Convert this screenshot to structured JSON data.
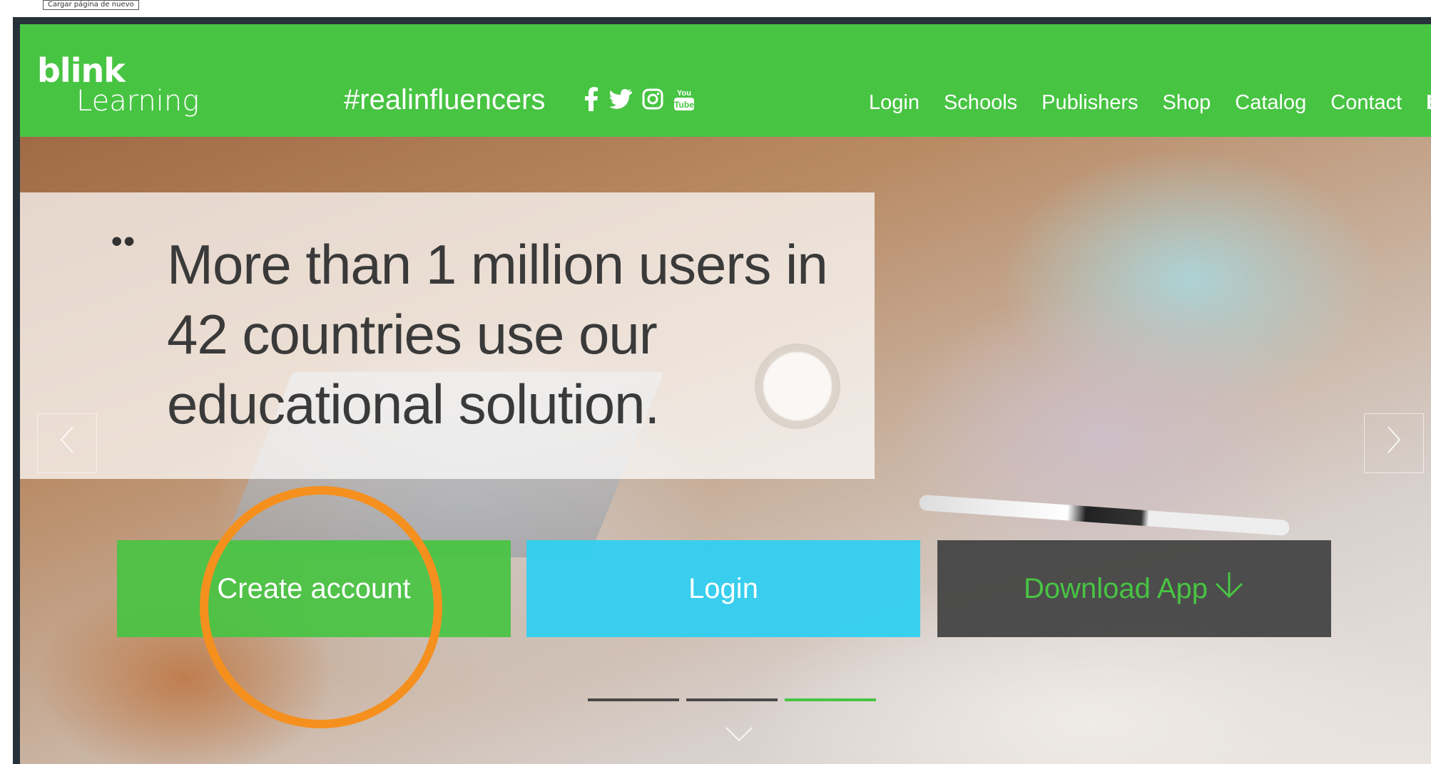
{
  "tooltip": {
    "text": "Cargar página de nuevo"
  },
  "header": {
    "logo": {
      "top": "blink",
      "bottom": "Learning"
    },
    "hashtag": "#realinfluencers",
    "social": [
      {
        "icon": "facebook-icon",
        "glyph": "f"
      },
      {
        "icon": "twitter-icon",
        "glyph": "🐦"
      },
      {
        "icon": "instagram-icon",
        "glyph": "◎"
      },
      {
        "icon": "youtube-icon",
        "glyph": "You Tube"
      }
    ],
    "nav": [
      "Login",
      "Schools",
      "Publishers",
      "Shop",
      "Catalog",
      "Contact"
    ],
    "language": "EN"
  },
  "hero": {
    "quote": "More than 1 million users in 42 countries use our educational solution.",
    "buttons": {
      "create": "Create account",
      "login": "Login",
      "download": "Download App"
    },
    "slides": {
      "count": 3,
      "active": 3
    }
  },
  "colors": {
    "brand_green": "#48c443",
    "login_blue": "#30cff0",
    "download_dark": "#444444",
    "highlight_orange": "#f5901e"
  }
}
